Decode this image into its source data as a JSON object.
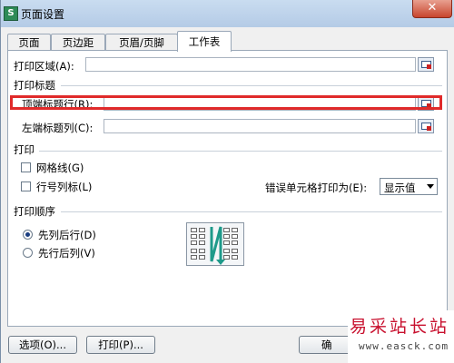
{
  "window": {
    "title": "页面设置",
    "app_icon": "wps-spreadsheet-icon",
    "close_label": "✕"
  },
  "tabs": [
    {
      "label": "页面",
      "active": false
    },
    {
      "label": "页边距",
      "active": false
    },
    {
      "label": "页眉/页脚",
      "active": false
    },
    {
      "label": "工作表",
      "active": true
    }
  ],
  "print_area": {
    "label": "打印区域(A):",
    "value": ""
  },
  "print_titles": {
    "group_label": "打印标题",
    "top_rows": {
      "label": "顶端标题行(R):",
      "value": ""
    },
    "left_columns": {
      "label": "左端标题列(C):",
      "value": ""
    }
  },
  "print": {
    "group_label": "打印",
    "gridlines": {
      "label": "网格线(G)",
      "checked": false
    },
    "row_col_headers": {
      "label": "行号列标(L)",
      "checked": false
    },
    "cell_errors": {
      "label": "错误单元格打印为(E):",
      "selected": "显示值"
    }
  },
  "page_order": {
    "group_label": "打印顺序",
    "options": [
      {
        "label": "先列后行(D)",
        "selected": true
      },
      {
        "label": "先行后列(V)",
        "selected": false
      }
    ]
  },
  "buttons": {
    "options": "选项(O)...",
    "print": "打印(P)...",
    "ok": "确"
  },
  "watermark": {
    "main": "易采站长站",
    "sub": "www.easck.com"
  },
  "colors": {
    "highlight": "#e02a2a",
    "titlebar": "#c9dcf0",
    "watermark": "#c8102e"
  }
}
